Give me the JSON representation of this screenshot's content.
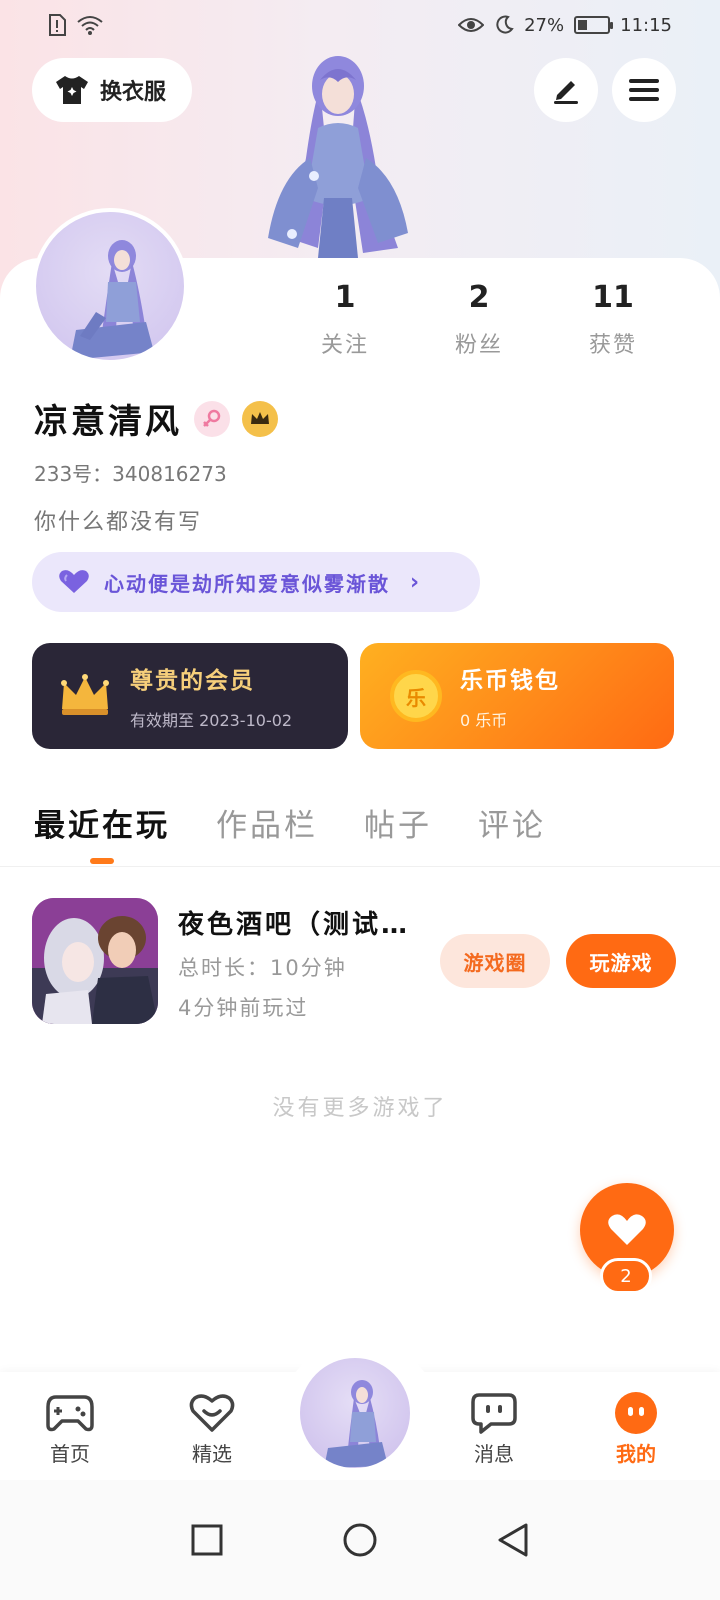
{
  "status_bar": {
    "battery": "27%",
    "time": "11:15"
  },
  "header": {
    "outfit_label": "换衣服"
  },
  "profile": {
    "stats": [
      {
        "value": "1",
        "label": "关注"
      },
      {
        "value": "2",
        "label": "粉丝"
      },
      {
        "value": "11",
        "label": "获赞"
      }
    ],
    "username": "凉意清风",
    "uid": "233号：340816273",
    "bio": "你什么都没有写",
    "signature": "心动便是劫所知爱意似雾渐散"
  },
  "cards": {
    "member_title": "尊贵的会员",
    "member_sub": "有效期至 2023-10-02",
    "wallet_title": "乐币钱包",
    "wallet_sub": "0 乐币",
    "coin_glyph": "乐"
  },
  "tabs": [
    {
      "label": "最近在玩"
    },
    {
      "label": "作品栏"
    },
    {
      "label": "帖子"
    },
    {
      "label": "评论"
    }
  ],
  "game": {
    "title": "夜色酒吧（测试…",
    "duration": "总时长：10分钟",
    "last_played": "4分钟前玩过",
    "circle_btn": "游戏圈",
    "play_btn": "玩游戏"
  },
  "no_more": "没有更多游戏了",
  "like_count": "2",
  "bottom_nav": {
    "home": "首页",
    "featured": "精选",
    "messages": "消息",
    "me": "我的"
  },
  "colors": {
    "accent": "#ff6a13",
    "signature": "#6a55d8",
    "member_bg": "#2a2637"
  }
}
